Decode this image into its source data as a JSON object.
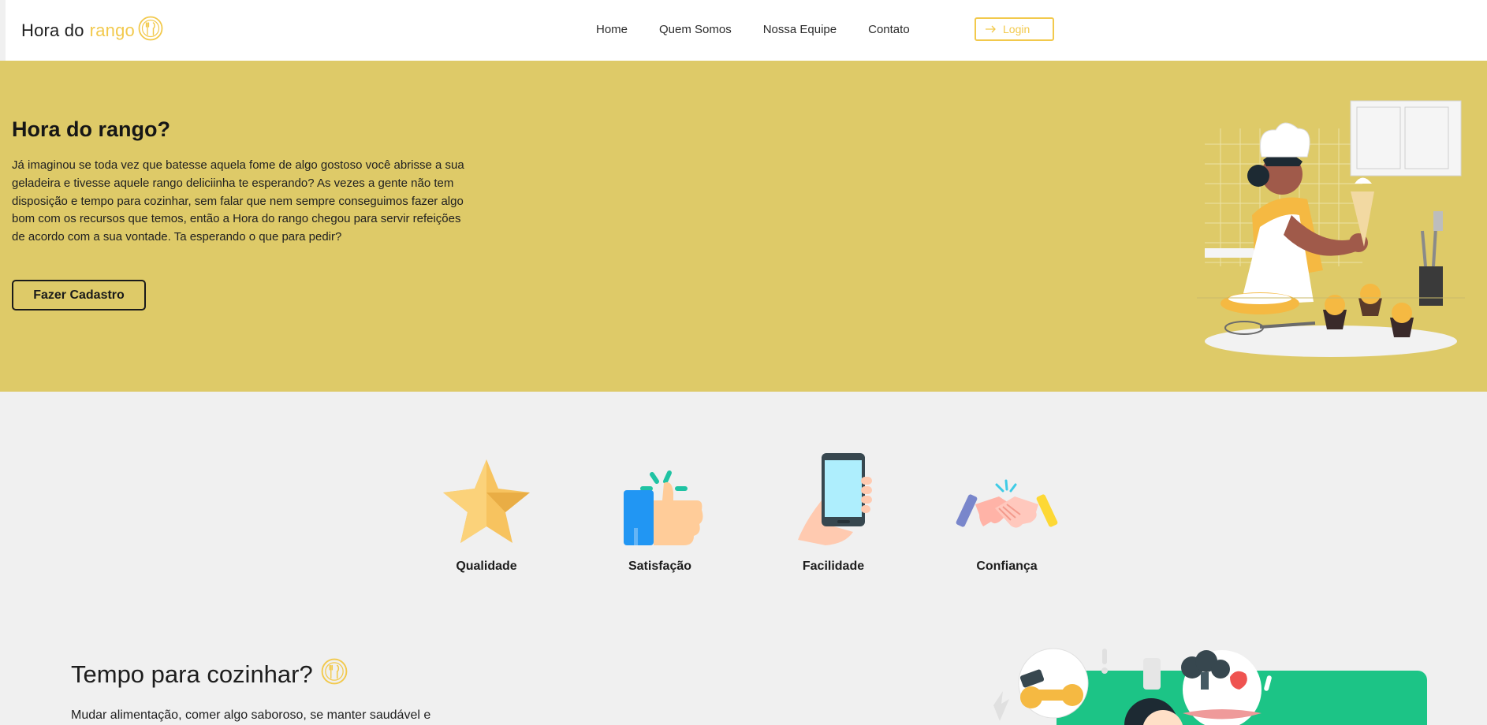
{
  "header": {
    "logo_part1": "Hora do",
    "logo_part2": "rango",
    "logo_icon": "fork-knife-circle-icon",
    "nav": [
      {
        "label": "Home"
      },
      {
        "label": "Quem Somos"
      },
      {
        "label": "Nossa Equipe"
      },
      {
        "label": "Contato"
      }
    ],
    "login_label": "Login",
    "login_icon": "login-arrow-icon"
  },
  "hero": {
    "title": "Hora do rango?",
    "text": "Já imaginou se toda vez que batesse aquela fome de algo gostoso você abrisse a sua geladeira e tivesse aquele rango deliciinha te esperando? As vezes a gente não tem disposição e tempo para cozinhar, sem falar que nem sempre conseguimos fazer algo bom com os recursos que temos, então a Hora do rango chegou para servir refeições de acordo com a sua vontade. Ta esperando o que para pedir?",
    "button_label": "Fazer Cadastro",
    "background": "#deca68"
  },
  "features": [
    {
      "label": "Qualidade",
      "icon": "star-icon"
    },
    {
      "label": "Satisfação",
      "icon": "thumbs-up-icon"
    },
    {
      "label": "Facilidade",
      "icon": "phone-in-hand-icon"
    },
    {
      "label": "Confiança",
      "icon": "handshake-icon"
    }
  ],
  "section2": {
    "title": "Tempo para cozinhar?",
    "text": "Mudar alimentação, comer algo saboroso, se manter saudável e"
  },
  "colors": {
    "accent": "#f2c94c",
    "green": "#1cc486"
  }
}
